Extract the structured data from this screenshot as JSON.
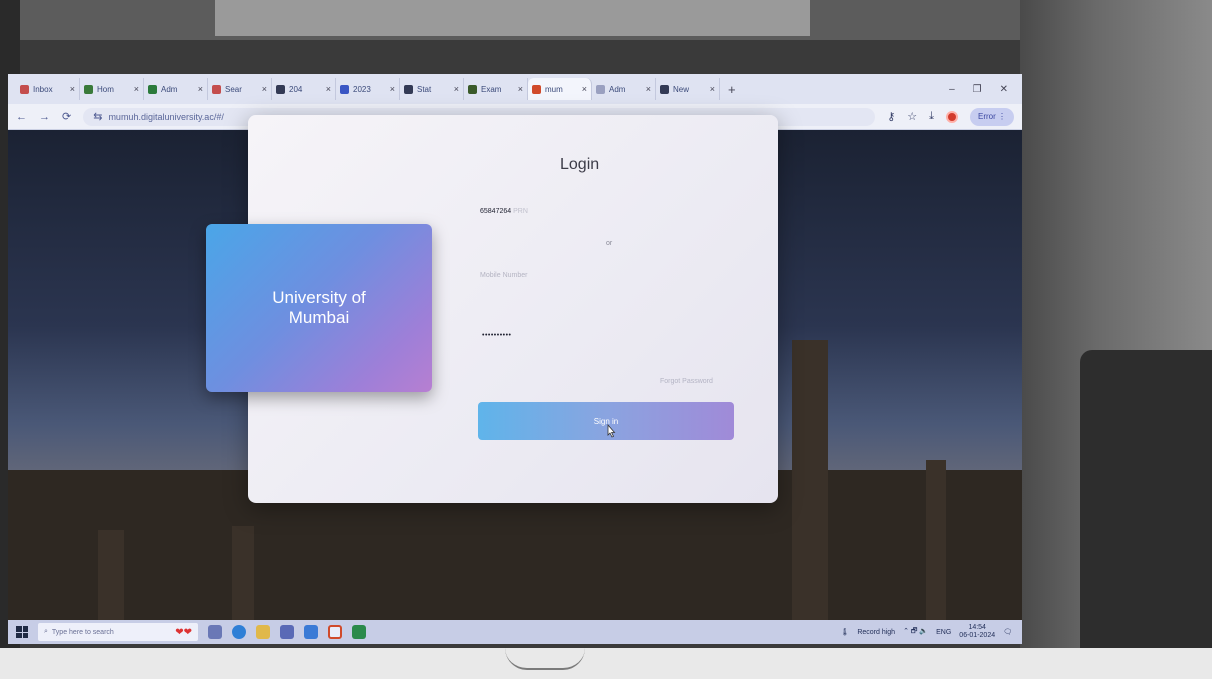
{
  "browser": {
    "tabs": [
      {
        "label": "Inbox",
        "favicon_color": "#c44d4d"
      },
      {
        "label": "Hom",
        "favicon_color": "#3a7a3a"
      },
      {
        "label": "Adm",
        "favicon_color": "#2b7a3b"
      },
      {
        "label": "Sear",
        "favicon_color": "#c44d4d"
      },
      {
        "label": "204",
        "favicon_color": "#333a55"
      },
      {
        "label": "2023",
        "favicon_color": "#3a56c4"
      },
      {
        "label": "Stat",
        "favicon_color": "#333a55"
      },
      {
        "label": "Exam",
        "favicon_color": "#3a5a2a"
      },
      {
        "label": "mum",
        "favicon_color": "#d04a2a"
      },
      {
        "label": "Adm",
        "favicon_color": "#9aa0c0"
      },
      {
        "label": "New",
        "favicon_color": "#333a55"
      }
    ],
    "active_tab_index": 8,
    "tab_close": "×",
    "new_tab": "+",
    "window_controls": [
      "–",
      "❐",
      "✕"
    ],
    "url": "mumuh.digitaluniversity.ac/#/",
    "nav": {
      "back": "←",
      "forward": "→",
      "reload": "⟳",
      "site_info": "⇆"
    },
    "toolbar_icons": {
      "key": "⚷",
      "star": "☆",
      "download": "⤓"
    },
    "error_chip": "Error ⋮"
  },
  "login": {
    "brand_name": "University of Mumbai",
    "title": "Login",
    "username_value": "65847264",
    "username_placeholder_tail": "PRN",
    "or_text": "or",
    "mobile_placeholder": "Mobile Number",
    "password_value": "••••••••••",
    "forgot_link": "Forgot Password",
    "signin_label": "Sign in"
  },
  "taskbar": {
    "search_placeholder": "Type here to search",
    "weather": "Record high",
    "language": "ENG",
    "time": "14:54",
    "date": "06-01-2024"
  },
  "colors": {
    "brand_gradient_start": "#4aa6e8",
    "brand_gradient_end": "#b77fd1",
    "button_gradient_start": "#5fb4ea",
    "button_gradient_end": "#a08ad8"
  }
}
